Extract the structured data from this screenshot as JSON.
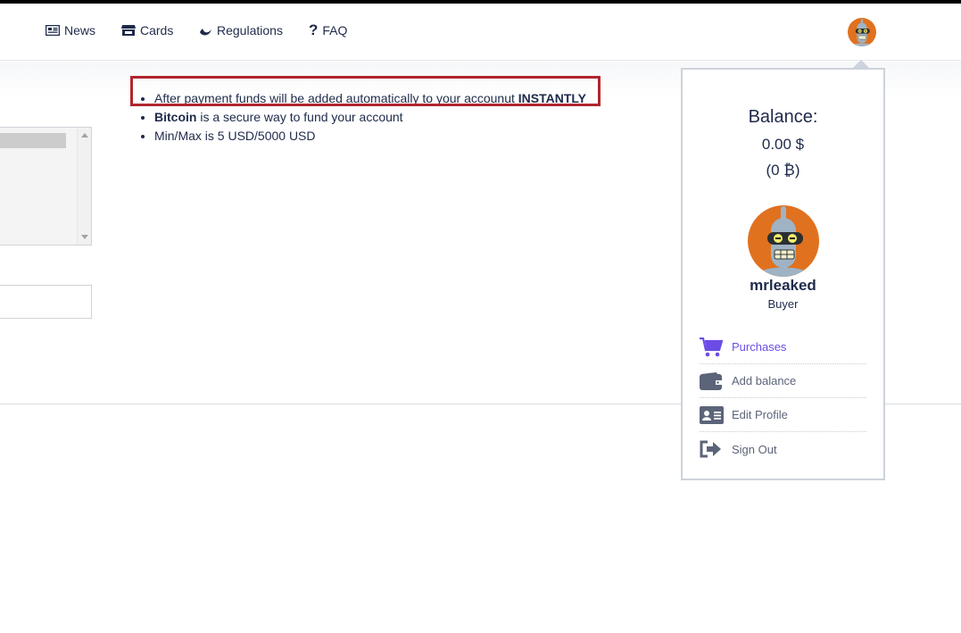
{
  "nav": {
    "items": [
      {
        "label": "News",
        "icon": "newspaper-icon"
      },
      {
        "label": "Cards",
        "icon": "store-icon"
      },
      {
        "label": "Regulations",
        "icon": "moon-icon"
      },
      {
        "label": "FAQ",
        "icon": "question-icon"
      }
    ]
  },
  "info": {
    "line1_text": "After payment funds will be added automatically to your accounut ",
    "line1_bold": "INSTANTLY",
    "line2_bold": "Bitcoin",
    "line2_text": " is a secure way to fund your account",
    "line3_text": "Min/Max is 5 USD/5000 USD"
  },
  "account": {
    "balance_title": "Balance:",
    "balance_usd": "0.00 $",
    "balance_btc": "(0 ₿)",
    "username": "mrleaked",
    "role": "Buyer",
    "menu": [
      {
        "label": "Purchases",
        "icon": "cart-icon"
      },
      {
        "label": "Add balance",
        "icon": "wallet-icon"
      },
      {
        "label": "Edit Profile",
        "icon": "id-card-icon"
      },
      {
        "label": "Sign Out",
        "icon": "sign-out-icon"
      }
    ]
  },
  "colors": {
    "text": "#1e2a4a",
    "highlight_border": "#b1262e",
    "active_menu": "#6c4ce6",
    "avatar_bg": "#e0711f"
  }
}
